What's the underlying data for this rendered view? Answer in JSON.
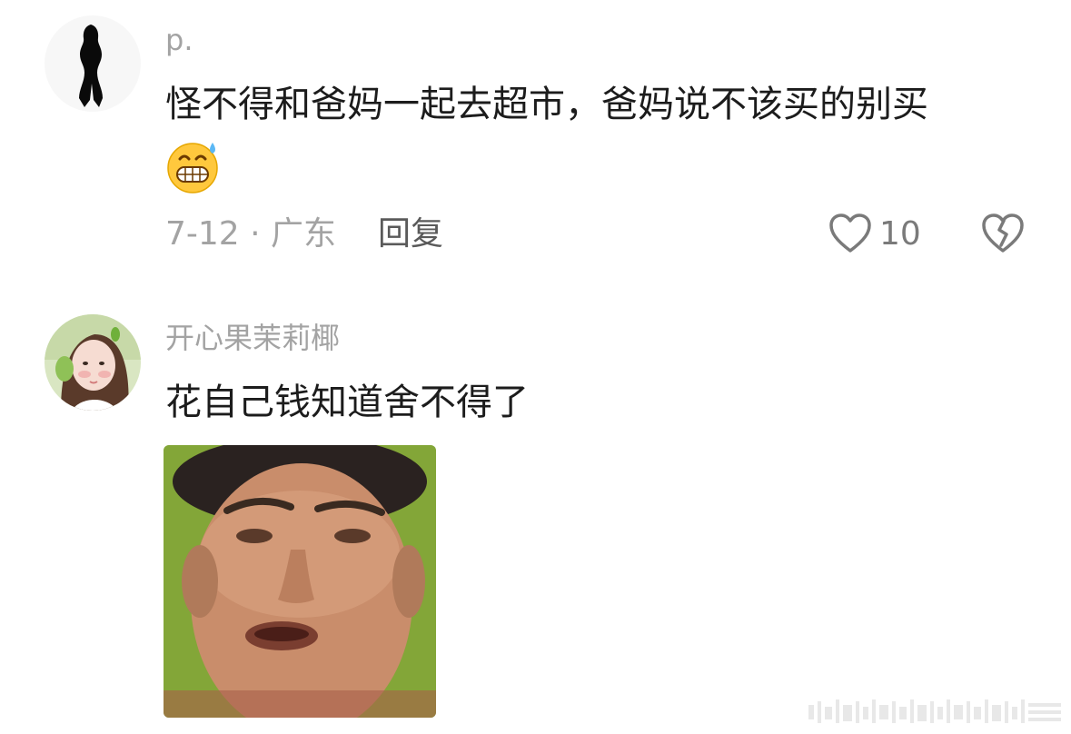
{
  "comments": [
    {
      "username": "p.",
      "text_line1": "怪不得和爸妈一起去超市，爸妈说不该买的别买",
      "emoji": "grimacing-sweat-emoji",
      "meta": "7-12 · 广东",
      "reply_label": "回复",
      "like_count": "10"
    },
    {
      "username": "开心果茉莉椰",
      "text_line1": "花自己钱知道舍不得了",
      "sticker": "man-face-sticker"
    }
  ],
  "colors": {
    "username": "#a3a3a3",
    "body_text": "#1c1c1c",
    "meta": "#a3a3a3",
    "icon_stroke": "#7a7a7a"
  },
  "icons": {
    "like": "heart-outline-icon",
    "dislike": "broken-heart-icon"
  }
}
